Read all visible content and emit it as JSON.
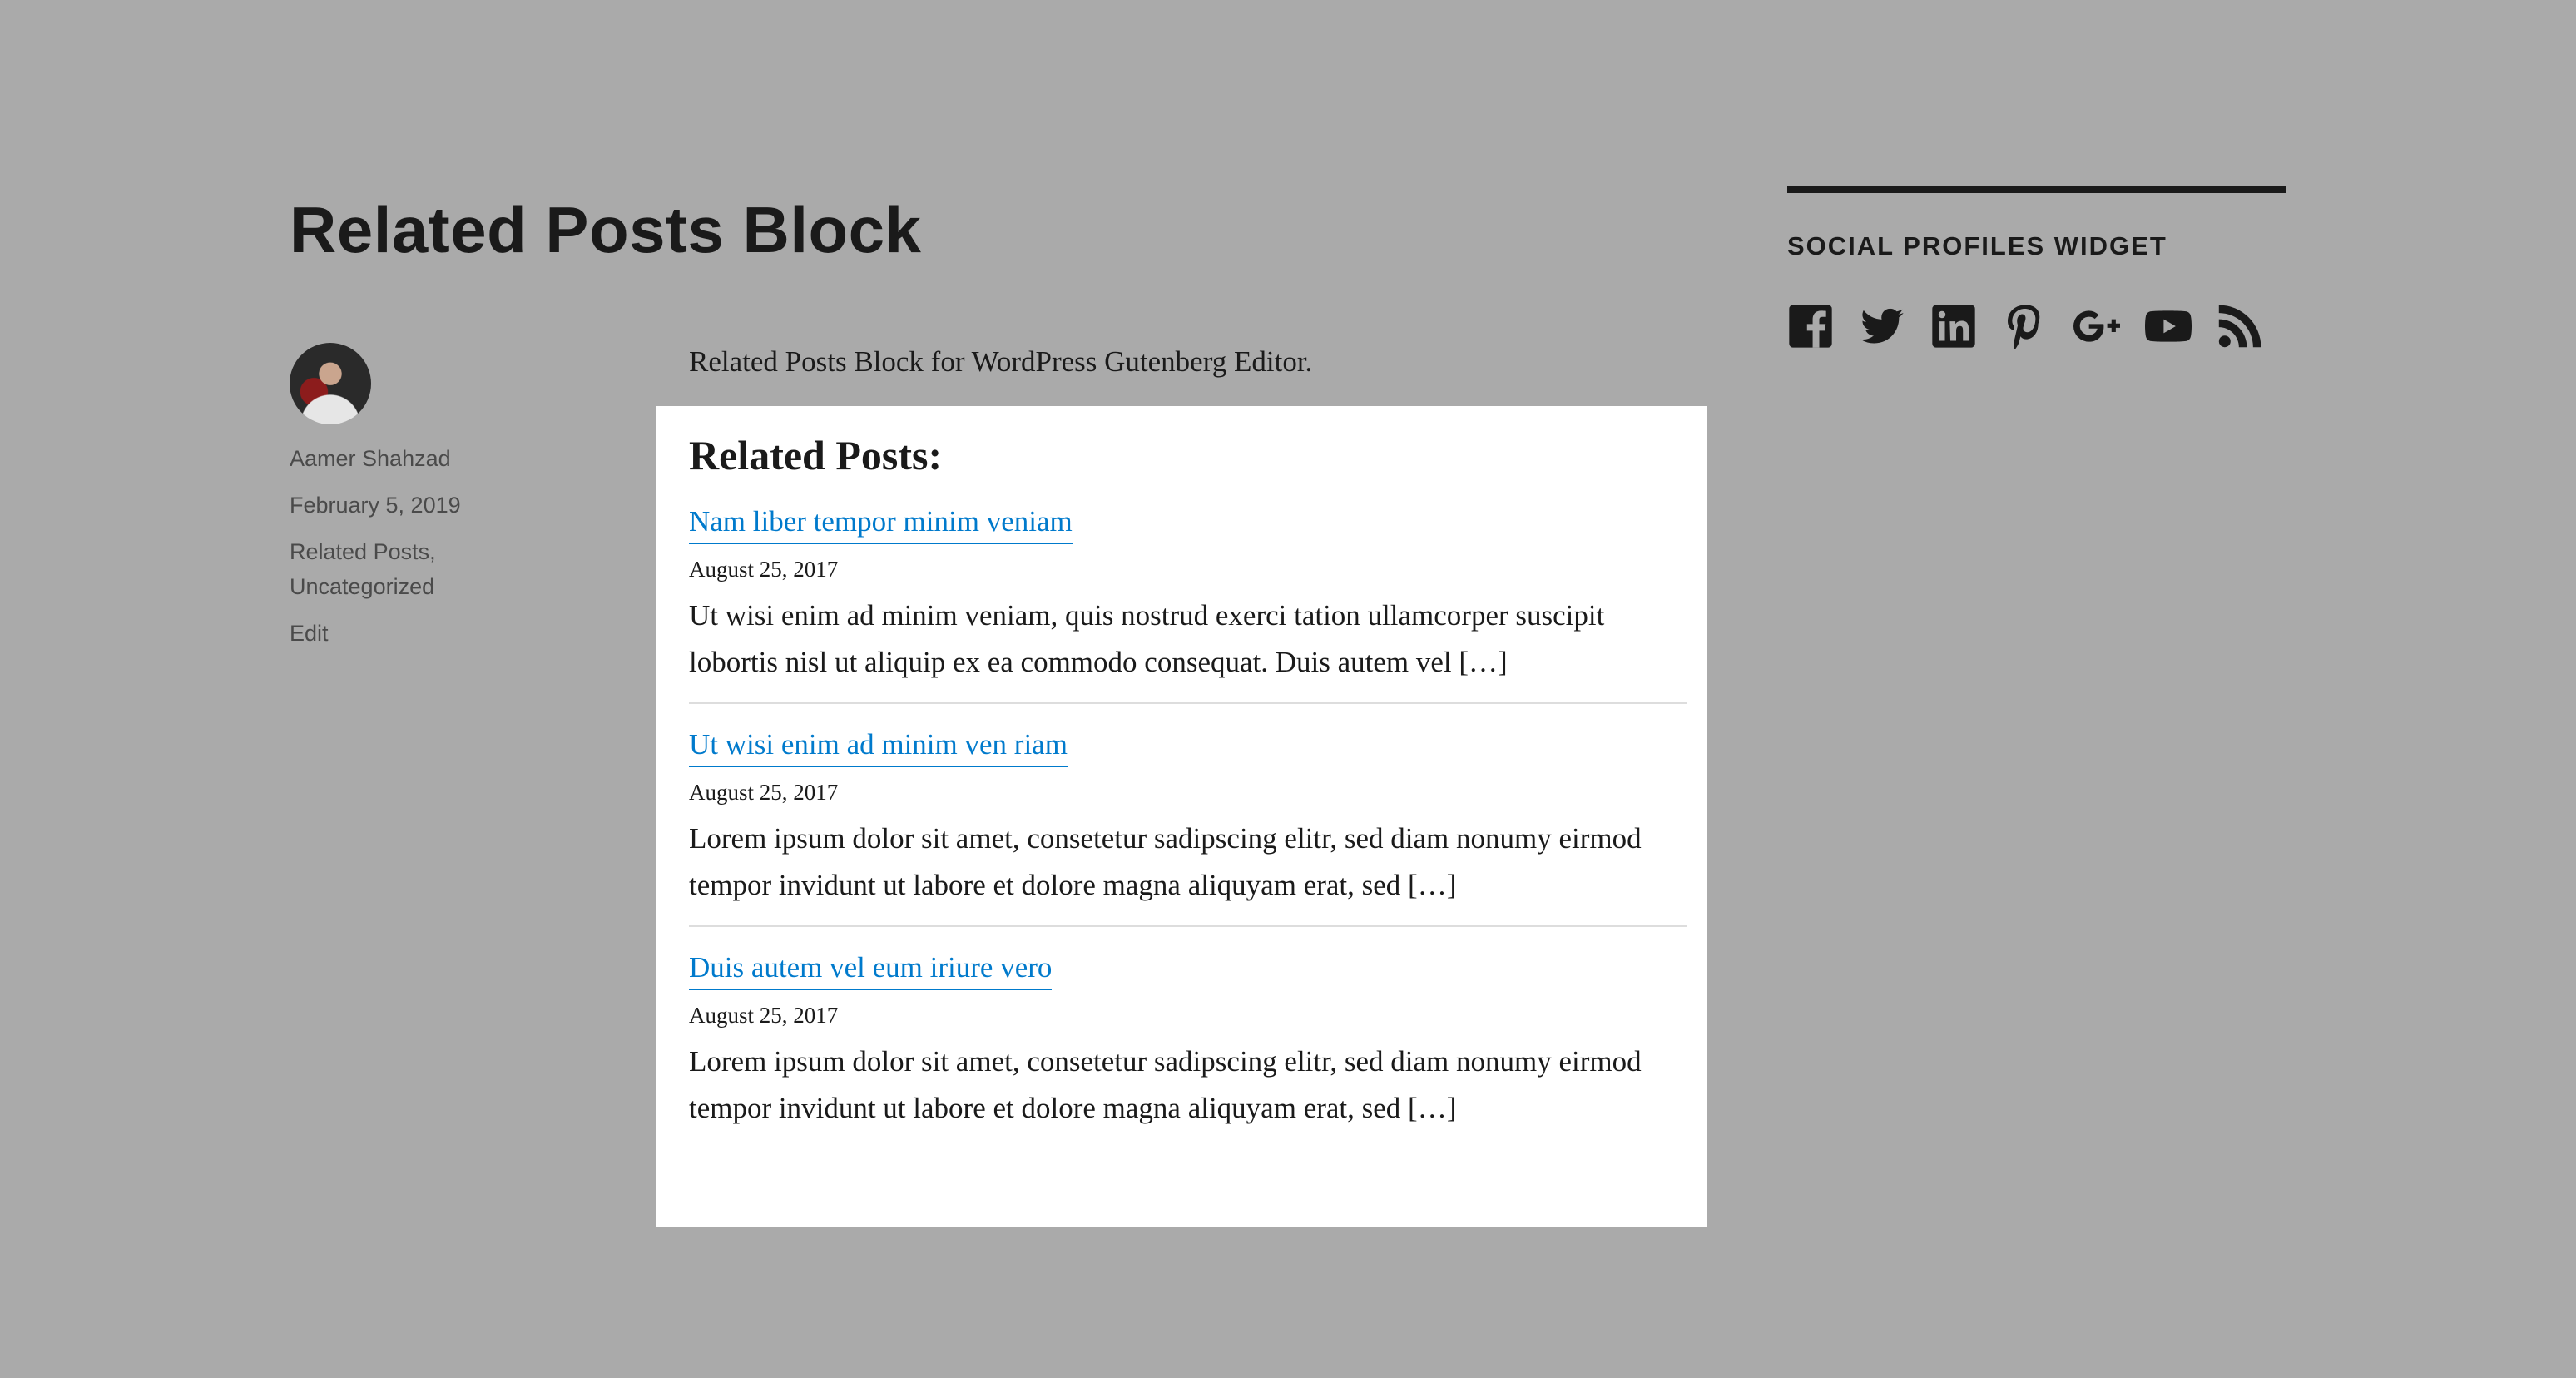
{
  "page": {
    "title": "Related Posts Block",
    "intro": "Related Posts Block for WordPress Gutenberg Editor."
  },
  "meta": {
    "author": "Aamer Shahzad",
    "date": "February 5, 2019",
    "categories": [
      "Related Posts,",
      "Uncategorized"
    ],
    "edit": "Edit"
  },
  "related": {
    "heading": "Related Posts:",
    "posts": [
      {
        "title": "Nam liber tempor minim veniam",
        "date": "August 25, 2017",
        "excerpt": "Ut wisi enim ad minim veniam, quis nostrud exerci tation ullamcorper suscipit lobortis nisl ut aliquip ex ea commodo consequat. Duis autem vel […]"
      },
      {
        "title": "Ut wisi enim ad minim ven riam",
        "date": "August 25, 2017",
        "excerpt": "Lorem ipsum dolor sit amet, consetetur sadipscing elitr, sed diam nonumy eirmod tempor invidunt ut labore et dolore magna aliquyam erat, sed […]"
      },
      {
        "title": "Duis autem vel eum iriure vero",
        "date": "August 25, 2017",
        "excerpt": "Lorem ipsum dolor sit amet, consetetur sadipscing elitr, sed diam nonumy eirmod tempor invidunt ut labore et dolore magna aliquyam erat, sed […]"
      }
    ]
  },
  "widget": {
    "title": "SOCIAL PROFILES WIDGET",
    "icons": [
      "facebook-icon",
      "twitter-icon",
      "linkedin-icon",
      "pinterest-icon",
      "google-plus-icon",
      "youtube-icon",
      "rss-icon"
    ]
  },
  "colors": {
    "background": "#aaaaaa",
    "link": "#007acc",
    "text": "#1a1a1a"
  }
}
